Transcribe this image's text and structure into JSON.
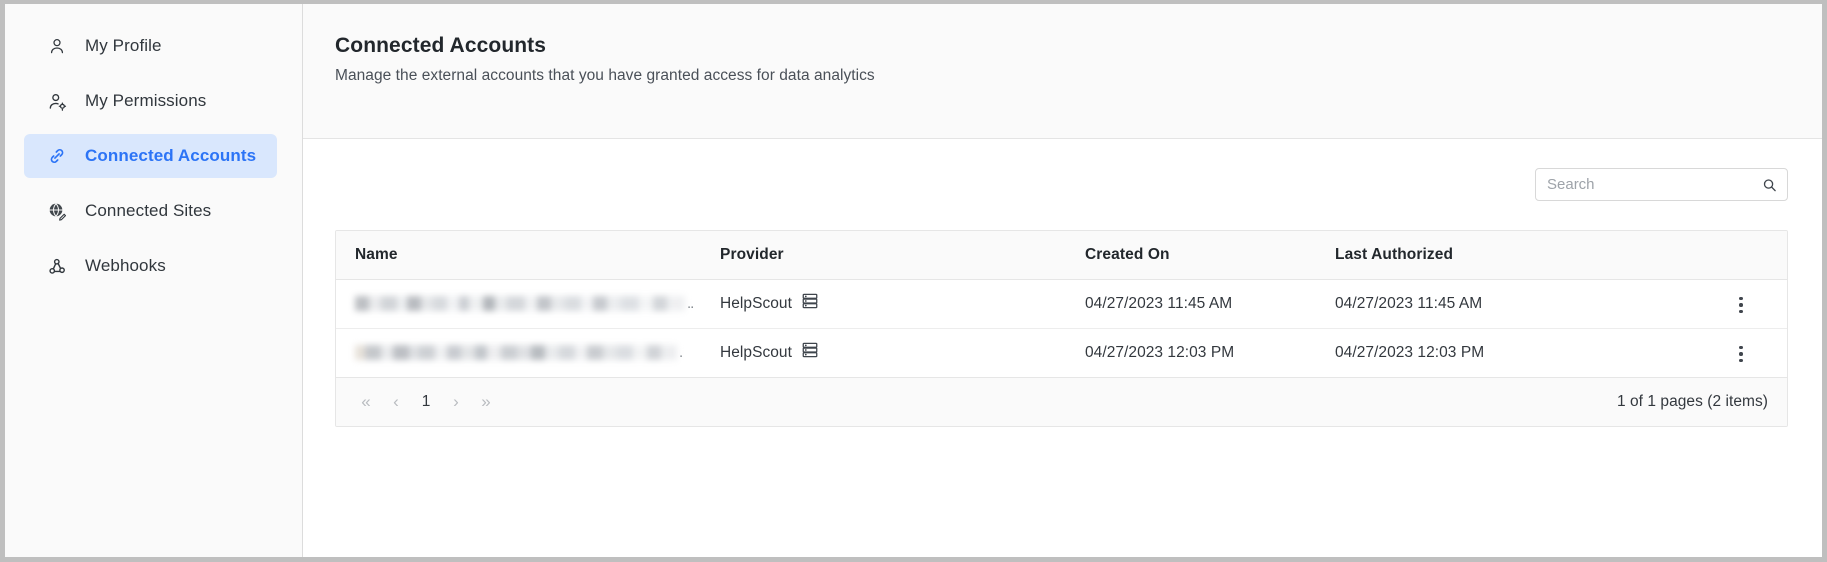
{
  "sidebar": {
    "items": [
      {
        "label": "My Profile",
        "icon": "user-icon",
        "active": false
      },
      {
        "label": "My Permissions",
        "icon": "user-gear-icon",
        "active": false
      },
      {
        "label": "Connected Accounts",
        "icon": "link-icon",
        "active": true
      },
      {
        "label": "Connected Sites",
        "icon": "globe-pencil-icon",
        "active": false
      },
      {
        "label": "Webhooks",
        "icon": "webhook-icon",
        "active": false
      }
    ]
  },
  "header": {
    "title": "Connected Accounts",
    "subtitle": "Manage the external accounts that you have granted access for data analytics"
  },
  "search": {
    "placeholder": "Search",
    "value": "",
    "icon": "search-icon"
  },
  "table": {
    "columns": [
      "Name",
      "Provider",
      "Created On",
      "Last Authorized"
    ],
    "rows": [
      {
        "name": "",
        "name_redacted": true,
        "name_truncation": "..",
        "provider": "HelpScout",
        "provider_icon": "server-stack-icon",
        "created_on": "04/27/2023 11:45 AM",
        "last_authorized": "04/27/2023 11:45 AM",
        "actions_icon": "kebab-menu-icon"
      },
      {
        "name": "",
        "name_redacted": true,
        "name_truncation": ".",
        "provider": "HelpScout",
        "provider_icon": "server-stack-icon",
        "created_on": "04/27/2023 12:03 PM",
        "last_authorized": "04/27/2023 12:03 PM",
        "actions_icon": "kebab-menu-icon"
      }
    ]
  },
  "pagination": {
    "first_label": "«",
    "prev_label": "‹",
    "current_page": "1",
    "next_label": "›",
    "last_label": "»",
    "summary": "1 of 1 pages (2 items)"
  },
  "colors": {
    "accent": "#2c74f6",
    "accent_bg": "#d9e7fd",
    "text": "#33383e",
    "panel_bg": "#fafafa",
    "border": "#e6e6e6"
  }
}
